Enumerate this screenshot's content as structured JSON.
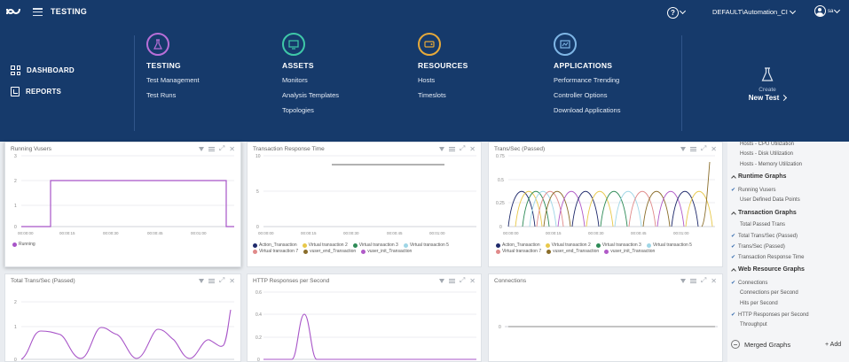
{
  "header": {
    "app_title": "TESTING",
    "help_icon": "?",
    "tenant": "DEFAULT\\Automation_CI",
    "user": "sa"
  },
  "menu": {
    "left": [
      {
        "label": "DASHBOARD",
        "icon": "grid-icon"
      },
      {
        "label": "REPORTS",
        "icon": "report-icon"
      }
    ],
    "columns": [
      {
        "title": "TESTING",
        "icon": "flask-icon",
        "color": "#b86fd8",
        "links": [
          "Test Management",
          "Test Runs"
        ]
      },
      {
        "title": "ASSETS",
        "icon": "monitor-icon",
        "color": "#3fc8a8",
        "links": [
          "Monitors",
          "Analysis Templates",
          "Topologies"
        ]
      },
      {
        "title": "RESOURCES",
        "icon": "server-icon",
        "color": "#e6a93a",
        "links": [
          "Hosts",
          "Timeslots"
        ]
      },
      {
        "title": "APPLICATIONS",
        "icon": "app-chart-icon",
        "color": "#7fb6e6",
        "links": [
          "Performance Trending",
          "Controller Options",
          "Download Applications"
        ]
      }
    ],
    "create": {
      "label": "Create",
      "new_test": "New Test"
    }
  },
  "panels": {
    "running_vusers": {
      "title": "Running Vusers",
      "y_ticks": [
        "3",
        "2",
        "1",
        "0"
      ],
      "x_ticks": [
        "00:00:00",
        "00:00:15",
        "00:00:30",
        "00:00:45",
        "00:01:00"
      ],
      "legend": [
        {
          "name": "Running",
          "color": "#a855c8"
        }
      ]
    },
    "trt": {
      "title": "Transaction Response Time",
      "y_ticks": [
        "10",
        "5",
        "0"
      ],
      "x_ticks": [
        "00:00:00",
        "00:00:15",
        "00:00:30",
        "00:00:45",
        "00:01:00"
      ],
      "legend": [
        {
          "name": "Action_Transaction",
          "color": "#1f2a6b"
        },
        {
          "name": "Virtual transaction 2",
          "color": "#e8c84a"
        },
        {
          "name": "Virtual transaction 3",
          "color": "#2e8b57"
        },
        {
          "name": "Virtual transaction 5",
          "color": "#9fd6e6"
        },
        {
          "name": "Virtual transaction 7",
          "color": "#e08a8a"
        },
        {
          "name": "vuser_end_Transaction",
          "color": "#8a6d2a"
        },
        {
          "name": "vuser_init_Transaction",
          "color": "#b05ac8"
        }
      ]
    },
    "tps_passed": {
      "title": "Trans/Sec (Passed)",
      "y_ticks": [
        "0.75",
        "0.5",
        "0.25",
        "0"
      ],
      "x_ticks": [
        "00:00:00",
        "00:00:15",
        "00:00:30",
        "00:00:45",
        "00:01:00"
      ],
      "legend": [
        {
          "name": "Action_Transaction",
          "color": "#1f2a6b"
        },
        {
          "name": "Virtual transaction 2",
          "color": "#e8c84a"
        },
        {
          "name": "Virtual transaction 3",
          "color": "#2e8b57"
        },
        {
          "name": "Virtual transaction 5",
          "color": "#9fd6e6"
        },
        {
          "name": "Virtual transaction 7",
          "color": "#e08a8a"
        },
        {
          "name": "vuser_end_Transaction",
          "color": "#8a6d2a"
        },
        {
          "name": "vuser_init_Transaction",
          "color": "#b05ac8"
        }
      ]
    },
    "total_tps": {
      "title": "Total Trans/Sec (Passed)",
      "y_ticks": [
        "2",
        "1",
        "0"
      ]
    },
    "http_rps": {
      "title": "HTTP Responses per Second",
      "y_ticks": [
        "0.6",
        "0.4",
        "0.2",
        "0"
      ]
    },
    "connections": {
      "title": "Connections",
      "y_ticks": [
        "0"
      ]
    }
  },
  "side": {
    "rows": [
      {
        "type": "item",
        "label": "Hosts - CPU Utilization"
      },
      {
        "type": "item",
        "label": "Hosts - Disk Utilization"
      },
      {
        "type": "item",
        "label": "Hosts - Memory Utilization"
      },
      {
        "type": "group",
        "label": "Runtime Graphs"
      },
      {
        "type": "check",
        "label": "Running Vusers"
      },
      {
        "type": "item",
        "label": "User Defined Data Points"
      },
      {
        "type": "group",
        "label": "Transaction Graphs"
      },
      {
        "type": "item",
        "label": "Total Passed Trans"
      },
      {
        "type": "check",
        "label": "Total Trans/Sec (Passed)"
      },
      {
        "type": "check",
        "label": "Trans/Sec (Passed)"
      },
      {
        "type": "check",
        "label": "Transaction Response Time"
      },
      {
        "type": "group",
        "label": "Web Resource Graphs"
      },
      {
        "type": "check",
        "label": "Connections"
      },
      {
        "type": "item",
        "label": "Connections per Second"
      },
      {
        "type": "item",
        "label": "Hits per Second"
      },
      {
        "type": "check",
        "label": "HTTP Responses per Second"
      },
      {
        "type": "item",
        "label": "Throughput"
      }
    ],
    "merged": "Merged Graphs",
    "add": "+ Add"
  }
}
